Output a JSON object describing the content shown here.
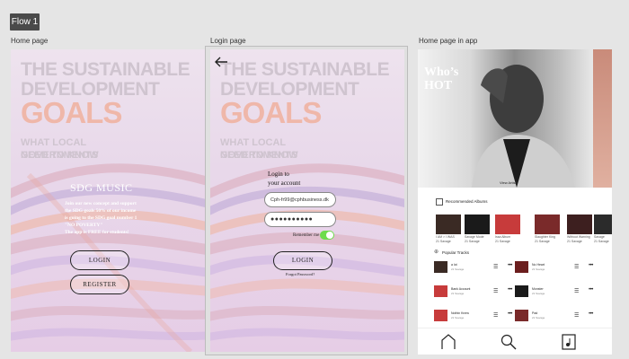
{
  "flow_tag": "Flow 1",
  "frames": {
    "home": {
      "label": "Home page"
    },
    "login": {
      "label": "Login page"
    },
    "app": {
      "label": "Home page in app"
    }
  },
  "poster": {
    "line1": "THE SUSTAINABLE",
    "line2": "DEVELOPMENT",
    "line3": "GOALS",
    "line4": "WHAT LOCAL GOVERNMENTS",
    "line5": "NEED TO KNOW"
  },
  "home_page": {
    "title": "SDG MUSIC",
    "body": [
      "Join our new concept and support",
      "the SDG goals 50% of our income",
      "is going to the SDG goal number 1",
      "\"NO POVERTY\"",
      "The app is FREE for students!"
    ],
    "login_button": "LOGIN",
    "register_button": "REGISTER"
  },
  "login_page": {
    "back_icon": "arrow-left-icon",
    "heading_line1": "Login to",
    "heading_line2": "your account",
    "email_value": "Cph-fr99@cphbusiness.dk",
    "password_value": "●●●●●●●●●●",
    "remember_label": "Remember me",
    "remember_on": true,
    "login_button": "LOGIN",
    "forgot_link": "Forgot Password?"
  },
  "app_page": {
    "hero_title_line1": "Who’s",
    "hero_title_line2": "HOT",
    "view_artist": "View Artist",
    "recommended_title": "Recommended Albums",
    "albums": [
      {
        "title": "I AM > I WAS",
        "artist": "21 Savage",
        "color": "#3a2a24"
      },
      {
        "title": "Savage Mode",
        "artist": "21 Savage",
        "color": "#1a1a1a"
      },
      {
        "title": "Issa Album",
        "artist": "21 Savage",
        "color": "#c73b3b"
      },
      {
        "title": "Slaughter King",
        "artist": "21 Savage",
        "color": "#7a2a2a"
      },
      {
        "title": "Without Warning",
        "artist": "21 Savage",
        "color": "#3d1f1f"
      },
      {
        "title": "Savage",
        "artist": "21 Savage",
        "color": "#2b2b2b"
      }
    ],
    "popular_title": "Popular Tracks",
    "tracks_left": [
      {
        "title": "a lot",
        "artist": "21 Savage",
        "color": "#3a2a24"
      },
      {
        "title": "Bank Account",
        "artist": "21 Savage",
        "color": "#c73b3b"
      },
      {
        "title": "Nothin Knew",
        "artist": "21 Savage",
        "color": "#c73b3b"
      }
    ],
    "tracks_right": [
      {
        "title": "No Heart",
        "artist": "21 Savage",
        "color": "#6b1e1e"
      },
      {
        "title": "Monster",
        "artist": "21 Savage",
        "color": "#1a1a1a"
      },
      {
        "title": "Pad",
        "artist": "21 Savage",
        "color": "#7a2a2a"
      }
    ],
    "nav": [
      "home-icon",
      "search-icon",
      "library-icon"
    ]
  },
  "colors": {
    "accent_pink": "#efb7a9",
    "toggle_green": "#6ddc4c"
  }
}
